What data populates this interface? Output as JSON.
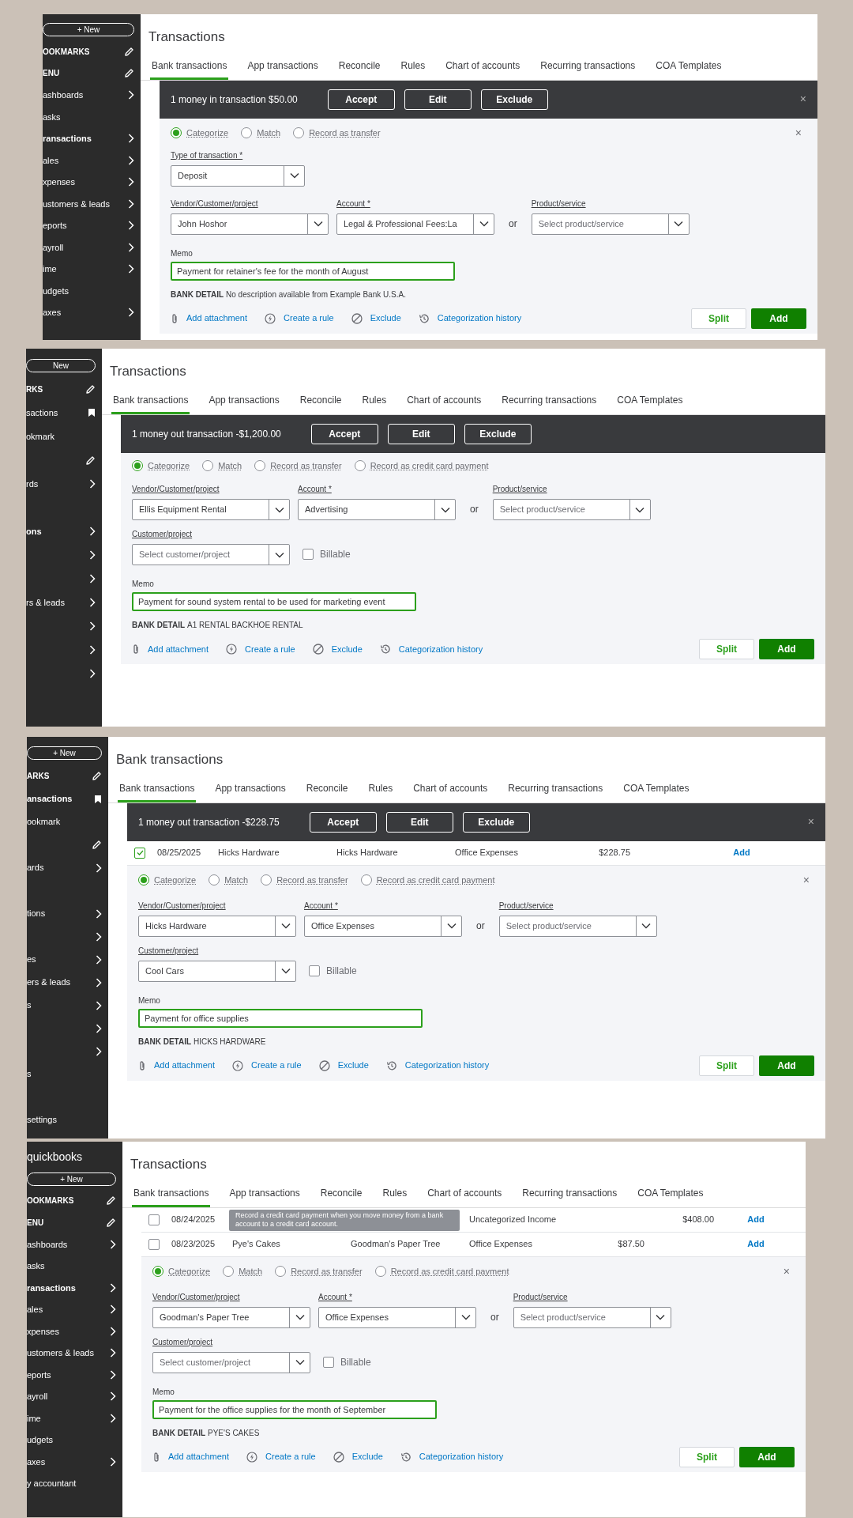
{
  "panels": [
    {
      "sidebar": [
        {
          "kind": "button",
          "label": "+ New"
        },
        {
          "kind": "header",
          "label": "OOKMARKS"
        },
        {
          "kind": "header",
          "label": "ENU"
        },
        {
          "kind": "nav",
          "label": "ashboards",
          "bold": false
        },
        {
          "kind": "nav_plain",
          "label": "asks",
          "bold": false
        },
        {
          "kind": "nav",
          "label": "ransactions",
          "bold": true
        },
        {
          "kind": "nav",
          "label": "ales",
          "bold": false
        },
        {
          "kind": "nav",
          "label": "xpenses",
          "bold": false
        },
        {
          "kind": "nav",
          "label": "ustomers & leads",
          "bold": false
        },
        {
          "kind": "nav",
          "label": "eports",
          "bold": false
        },
        {
          "kind": "nav",
          "label": "ayroll",
          "bold": false
        },
        {
          "kind": "nav",
          "label": "ime",
          "bold": false
        },
        {
          "kind": "nav_plain",
          "label": "udgets",
          "bold": false
        },
        {
          "kind": "nav",
          "label": "axes",
          "bold": false
        }
      ],
      "title": "Transactions",
      "tabs": [
        {
          "label": "Bank transactions",
          "selected": true
        },
        {
          "label": "App transactions",
          "selected": false
        },
        {
          "label": "Reconcile",
          "selected": false
        },
        {
          "label": "Rules",
          "selected": false
        },
        {
          "label": "Chart of accounts",
          "selected": false
        },
        {
          "label": "Recurring transactions",
          "selected": false
        },
        {
          "label": "COA Templates",
          "selected": false
        }
      ],
      "banner": {
        "text": "1 money in transaction $50.00",
        "buttons": [
          "Accept",
          "Edit",
          "Exclude"
        ],
        "close": "×"
      },
      "form": {
        "options": [
          {
            "label": "Categorize",
            "selected": true
          },
          {
            "label": "Match",
            "selected": false
          },
          {
            "label": "Record as transfer",
            "selected": false
          }
        ],
        "close": "×",
        "type_field": {
          "label": "Type of transaction *",
          "value": "Deposit"
        },
        "fields": [
          {
            "label": "Vendor/Customer/project",
            "value": "John Hoshor"
          },
          {
            "label": "Account *",
            "value": "Legal & Professional Fees:La"
          },
          {
            "label": "Product/service",
            "placeholder": "Select product/service"
          }
        ],
        "or": "or",
        "memo": {
          "label": "Memo",
          "value": "Payment for retainer's fee for the month of August"
        },
        "bank_detail": {
          "label": "BANK DETAIL",
          "text": "No description available from Example Bank U.S.A."
        },
        "links": [
          {
            "kind": "attachment",
            "label": "Add attachment"
          },
          {
            "kind": "rule",
            "label": "Create a rule"
          },
          {
            "kind": "exclude",
            "label": "Exclude"
          },
          {
            "kind": "history",
            "label": "Categorization history"
          }
        ],
        "buttons": [
          "Split",
          "Add"
        ]
      }
    },
    {
      "sidebar": [
        {
          "kind": "button",
          "label": "New"
        },
        {
          "kind": "header",
          "label": "RKS"
        },
        {
          "kind": "bookmarked",
          "label": "sactions",
          "bold": false
        },
        {
          "kind": "nav_plain",
          "label": "okmark",
          "bold": false
        },
        {
          "kind": "header"
        },
        {
          "kind": "nav",
          "label": "rds",
          "bold": false
        },
        {
          "kind": "nav_plain"
        },
        {
          "kind": "nav",
          "label": "ons",
          "bold": true
        },
        {
          "kind": "nav"
        },
        {
          "kind": "nav"
        },
        {
          "kind": "nav",
          "label": "rs & leads",
          "bold": false
        },
        {
          "kind": "nav"
        },
        {
          "kind": "nav"
        },
        {
          "kind": "nav"
        }
      ],
      "title": "Transactions",
      "tabs": [
        {
          "label": "Bank transactions",
          "selected": true
        },
        {
          "label": "App transactions",
          "selected": false
        },
        {
          "label": "Reconcile",
          "selected": false
        },
        {
          "label": "Rules",
          "selected": false
        },
        {
          "label": "Chart of accounts",
          "selected": false
        },
        {
          "label": "Recurring transactions",
          "selected": false
        },
        {
          "label": "COA Templates",
          "selected": false
        }
      ],
      "banner": {
        "text": "1 money out transaction -$1,200.00",
        "buttons": [
          "Accept",
          "Edit",
          "Exclude"
        ]
      },
      "form": {
        "options": [
          {
            "label": "Categorize",
            "selected": true
          },
          {
            "label": "Match",
            "selected": false
          },
          {
            "label": "Record as transfer",
            "selected": false
          },
          {
            "label": "Record as credit card payment",
            "selected": false
          }
        ],
        "fields": [
          {
            "label": "Vendor/Customer/project",
            "value": "Ellis Equipment Rental"
          },
          {
            "label": "Account *",
            "value": "Advertising"
          },
          {
            "label": "Product/service",
            "placeholder": "Select product/service"
          }
        ],
        "or": "or",
        "customer": {
          "label": "Customer/project",
          "placeholder": "Select customer/project"
        },
        "billable": {
          "label": "Billable",
          "checked": false
        },
        "memo": {
          "label": "Memo",
          "value": "Payment for sound system rental to be used for marketing event"
        },
        "bank_detail": {
          "label": "BANK DETAIL",
          "text": "A1 RENTAL BACKHOE RENTAL"
        },
        "links": [
          {
            "kind": "attachment",
            "label": "Add attachment"
          },
          {
            "kind": "rule",
            "label": "Create a rule"
          },
          {
            "kind": "exclude",
            "label": "Exclude"
          },
          {
            "kind": "history",
            "label": "Categorization history"
          }
        ],
        "buttons": [
          "Split",
          "Add"
        ]
      }
    },
    {
      "sidebar": [
        {
          "kind": "button",
          "label": "+ New"
        },
        {
          "kind": "header",
          "label": "ARKS"
        },
        {
          "kind": "bookmarked",
          "label": "ansactions",
          "bold": true
        },
        {
          "kind": "nav_plain",
          "label": "ookmark",
          "bold": false
        },
        {
          "kind": "header"
        },
        {
          "kind": "nav",
          "label": "ards",
          "bold": false
        },
        {
          "kind": "nav_plain"
        },
        {
          "kind": "nav",
          "label": "tions",
          "bold": false
        },
        {
          "kind": "nav"
        },
        {
          "kind": "nav",
          "label": "es",
          "bold": false
        },
        {
          "kind": "nav",
          "label": "ers & leads",
          "bold": false
        },
        {
          "kind": "nav",
          "label": "s",
          "bold": false
        },
        {
          "kind": "nav"
        },
        {
          "kind": "nav"
        },
        {
          "kind": "nav_plain",
          "label": "s",
          "bold": false
        },
        {
          "kind": "nav_plain"
        },
        {
          "kind": "nav_plain",
          "label": "settings",
          "bold": false
        }
      ],
      "title": "Bank transactions",
      "tabs": [
        {
          "label": "Bank transactions",
          "selected": true
        },
        {
          "label": "App transactions",
          "selected": false
        },
        {
          "label": "Reconcile",
          "selected": false
        },
        {
          "label": "Rules",
          "selected": false
        },
        {
          "label": "Chart of accounts",
          "selected": false
        },
        {
          "label": "Recurring transactions",
          "selected": false
        },
        {
          "label": "COA Templates",
          "selected": false
        }
      ],
      "banner": {
        "text": "1 money out transaction -$228.75",
        "buttons": [
          "Accept",
          "Edit",
          "Exclude"
        ],
        "close": "×"
      },
      "rows": [
        {
          "checked": true,
          "date": "08/25/2025",
          "column_2": "Hicks Hardware",
          "column_3": "Hicks Hardware",
          "column_4": "Office Expenses",
          "column_5": "$228.75",
          "action": "Add"
        }
      ],
      "form": {
        "options": [
          {
            "label": "Categorize",
            "selected": true
          },
          {
            "label": "Match",
            "selected": false
          },
          {
            "label": "Record as transfer",
            "selected": false
          },
          {
            "label": "Record as credit card payment",
            "selected": false
          }
        ],
        "close": "×",
        "fields": [
          {
            "label": "Vendor/Customer/project",
            "value": "Hicks Hardware"
          },
          {
            "label": "Account *",
            "value": "Office Expenses"
          },
          {
            "label": "Product/service",
            "placeholder": "Select product/service"
          }
        ],
        "or": "or",
        "customer": {
          "label": "Customer/project",
          "value": "Cool Cars"
        },
        "billable": {
          "label": "Billable",
          "checked": false
        },
        "memo": {
          "label": "Memo",
          "value": "Payment for office supplies"
        },
        "bank_detail": {
          "label": "BANK DETAIL",
          "text": "HICKS HARDWARE"
        },
        "links": [
          {
            "kind": "attachment",
            "label": "Add attachment"
          },
          {
            "kind": "rule",
            "label": "Create a rule"
          },
          {
            "kind": "exclude",
            "label": "Exclude"
          },
          {
            "kind": "history",
            "label": "Categorization history"
          }
        ],
        "buttons": [
          "Split",
          "Add"
        ]
      }
    },
    {
      "sidebar": [
        {
          "kind": "logo",
          "label": "quickbooks"
        },
        {
          "kind": "button",
          "label": "+ New"
        },
        {
          "kind": "header",
          "label": "OOKMARKS"
        },
        {
          "kind": "header",
          "label": "ENU"
        },
        {
          "kind": "nav",
          "label": "ashboards",
          "bold": false
        },
        {
          "kind": "nav_plain",
          "label": "asks",
          "bold": false
        },
        {
          "kind": "nav",
          "label": "ransactions",
          "bold": true
        },
        {
          "kind": "nav",
          "label": "ales",
          "bold": false
        },
        {
          "kind": "nav",
          "label": "xpenses",
          "bold": false
        },
        {
          "kind": "nav",
          "label": "ustomers & leads",
          "bold": false
        },
        {
          "kind": "nav",
          "label": "eports",
          "bold": false
        },
        {
          "kind": "nav",
          "label": "ayroll",
          "bold": false
        },
        {
          "kind": "nav",
          "label": "ime",
          "bold": false
        },
        {
          "kind": "nav_plain",
          "label": "udgets",
          "bold": false
        },
        {
          "kind": "nav",
          "label": "axes",
          "bold": false
        },
        {
          "kind": "nav_plain",
          "label": "y accountant",
          "bold": false
        }
      ],
      "title": "Transactions",
      "tabs": [
        {
          "label": "Bank transactions",
          "selected": true
        },
        {
          "label": "App transactions",
          "selected": false
        },
        {
          "label": "Reconcile",
          "selected": false
        },
        {
          "label": "Rules",
          "selected": false
        },
        {
          "label": "Chart of accounts",
          "selected": false
        },
        {
          "label": "Recurring transactions",
          "selected": false
        },
        {
          "label": "COA Templates",
          "selected": false
        }
      ],
      "rows": [
        {
          "checked": false,
          "date": "08/24/2025",
          "column_4": "Uncategorized Income",
          "column_6": "$408.00",
          "action": "Add"
        },
        {
          "checked": false,
          "date": "08/23/2025",
          "column_2": "Pye's Cakes",
          "column_3": "Goodman's Paper Tree",
          "column_4": "Office Expenses",
          "column_5": "$87.50",
          "action": "Add"
        }
      ],
      "tooltip": "Record a credit card payment when you move money from a bank account to a credit card account.",
      "form": {
        "options": [
          {
            "label": "Categorize",
            "selected": true
          },
          {
            "label": "Match",
            "selected": false
          },
          {
            "label": "Record as transfer",
            "selected": false
          },
          {
            "label": "Record as credit card payment",
            "selected": false
          }
        ],
        "close": "×",
        "fields": [
          {
            "label": "Vendor/Customer/project",
            "value": "Goodman's Paper Tree"
          },
          {
            "label": "Account *",
            "value": "Office Expenses"
          },
          {
            "label": "Product/service",
            "placeholder": "Select product/service"
          }
        ],
        "or": "or",
        "customer": {
          "label": "Customer/project",
          "placeholder": "Select customer/project"
        },
        "billable": {
          "label": "Billable",
          "checked": false
        },
        "memo": {
          "label": "Memo",
          "value": "Payment for the office supplies for the month of September"
        },
        "bank_detail": {
          "label": "BANK DETAIL",
          "text": "PYE'S CAKES"
        },
        "links": [
          {
            "kind": "attachment",
            "label": "Add attachment"
          },
          {
            "kind": "rule",
            "label": "Create a rule"
          },
          {
            "kind": "exclude",
            "label": "Exclude"
          },
          {
            "kind": "history",
            "label": "Categorization history"
          }
        ],
        "buttons": [
          "Split",
          "Add"
        ]
      }
    }
  ]
}
